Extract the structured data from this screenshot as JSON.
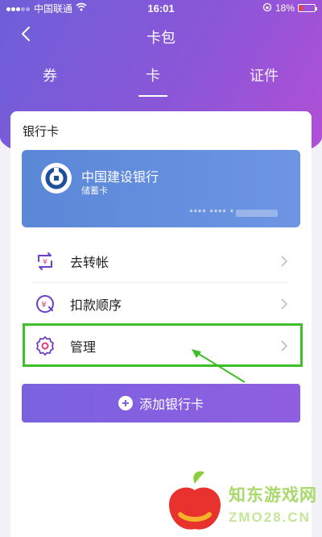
{
  "status_bar": {
    "carrier": "中国联通",
    "time": "16:01",
    "battery": "18%"
  },
  "nav": {
    "title": "卡包"
  },
  "tabs": [
    {
      "label": "券"
    },
    {
      "label": "卡"
    },
    {
      "label": "证件"
    }
  ],
  "bank_section": {
    "title": "银行卡",
    "card": {
      "bank_name": "中国建设银行",
      "card_type": "储蓄卡",
      "number_masked": "**** **** *"
    },
    "menu": [
      {
        "label": "去转帐",
        "icon": "transfer-icon"
      },
      {
        "label": "扣款顺序",
        "icon": "payment-order-icon"
      },
      {
        "label": "管理",
        "icon": "gear-icon"
      }
    ],
    "add_button": "添加银行卡"
  },
  "colors": {
    "accent": "#8b56d8",
    "highlight": "#3fbf27",
    "card": "#5b87d8"
  },
  "watermark": {
    "line1": "知东游戏网",
    "line2": "ZMO28.CN"
  }
}
